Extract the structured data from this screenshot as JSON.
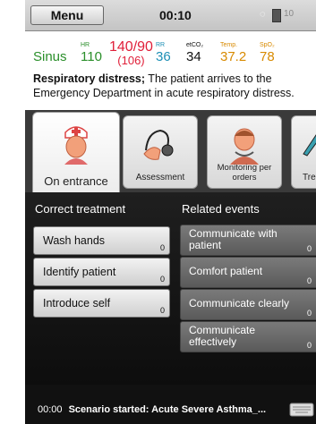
{
  "status_bar": {
    "menu_label": "Menu",
    "clock": "00:10",
    "battery_text": "10"
  },
  "vitals": {
    "rhythm": "Sinus",
    "hr": {
      "label": "HR",
      "value": "110",
      "color": "#2a8f2a"
    },
    "bp": {
      "value": "140/90",
      "mean": "(106)",
      "color": "#e0203a"
    },
    "rr": {
      "label": "RR",
      "value": "36",
      "color": "#1d8fb5"
    },
    "etco2": {
      "label": "etCO₂",
      "value": "34",
      "color": "#111111"
    },
    "temp": {
      "label": "Temp.",
      "value": "37.2",
      "color": "#d88a00"
    },
    "spo2": {
      "label": "SpO₂",
      "value": "78",
      "color": "#d88a00"
    }
  },
  "description": {
    "bold": "Respiratory distress;",
    "text": " The patient arrives to the Emergency Department in acute respiratory distress."
  },
  "tabs": [
    {
      "label": "On entrance",
      "icon": "nurse-icon",
      "active": true
    },
    {
      "label": "Assessment",
      "icon": "stethoscope-icon",
      "active": false
    },
    {
      "label": "Monitoring per orders",
      "icon": "monitoring-icon",
      "active": false
    },
    {
      "label": "Tre",
      "icon": "treatment-icon",
      "active": false
    }
  ],
  "treatment": {
    "header": "Correct treatment",
    "items": [
      {
        "label": "Wash hands",
        "count": "0"
      },
      {
        "label": "Identify patient",
        "count": "0"
      },
      {
        "label": "Introduce self",
        "count": "0"
      }
    ]
  },
  "events": {
    "header": "Related events",
    "items": [
      {
        "label": "Communicate with patient",
        "count": "0"
      },
      {
        "label": "Comfort patient",
        "count": "0"
      },
      {
        "label": "Communicate clearly",
        "count": "0"
      },
      {
        "label": "Communicate effectively",
        "count": "0"
      }
    ]
  },
  "log": {
    "time": "00:00",
    "text": "Scenario started: Acute Severe Asthma_..."
  }
}
